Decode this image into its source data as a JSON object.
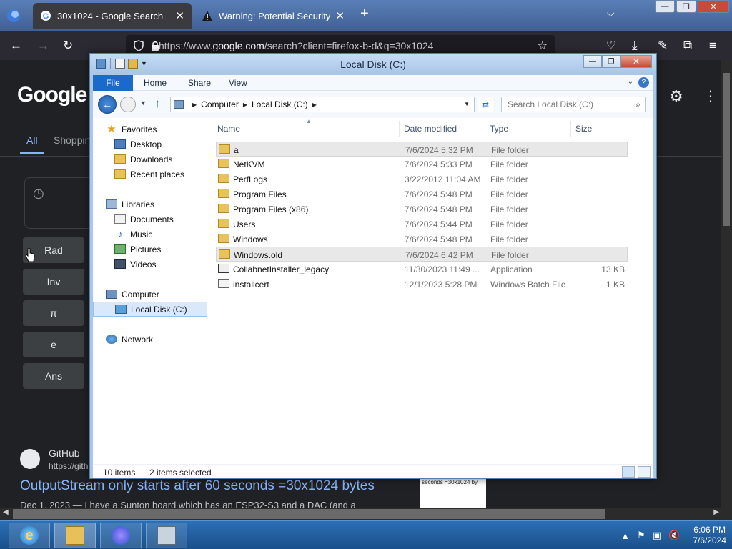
{
  "browser": {
    "tabs": [
      {
        "title": "30x1024 - Google Search",
        "icon": "google-icon",
        "active": true
      },
      {
        "title": "Warning: Potential Security Risk",
        "icon": "warning-icon",
        "active": false
      }
    ],
    "url_prefix": "https://www.",
    "url_domain": "google.com",
    "url_rest": "/search?client=firefox-b-d&q=30x1024",
    "window_controls": {
      "minimize": "—",
      "restore": "❐",
      "close": "✕"
    }
  },
  "google": {
    "logo": "Google",
    "tabs": [
      "All",
      "Shopping"
    ],
    "calculator_buttons": [
      "Rad",
      "Inv",
      "π",
      "e",
      "Ans"
    ],
    "result": {
      "site_name": "GitHub",
      "site_url": "https://githu",
      "title": "OutputStream only starts after 60 seconds =30x1024 bytes",
      "snippet": "Dec 1, 2023 — I have a Sunton board which has an ESP32-S3 and a DAC (and a",
      "thumb_text": "seconds =30x1024 by"
    }
  },
  "explorer": {
    "title": "Local Disk (C:)",
    "ribbon_tabs": [
      "File",
      "Home",
      "Share",
      "View"
    ],
    "breadcrumb": [
      "Computer",
      "Local Disk (C:)"
    ],
    "search_placeholder": "Search Local Disk (C:)",
    "nav": [
      {
        "label": "Favorites",
        "icon": "star-icon",
        "level": "root"
      },
      {
        "label": "Desktop",
        "icon": "desktop-icon",
        "level": "child"
      },
      {
        "label": "Downloads",
        "icon": "downloads-folder-icon",
        "level": "child"
      },
      {
        "label": "Recent places",
        "icon": "recent-places-icon",
        "level": "child"
      },
      {
        "label": "Libraries",
        "icon": "libraries-icon",
        "level": "root"
      },
      {
        "label": "Documents",
        "icon": "documents-icon",
        "level": "child"
      },
      {
        "label": "Music",
        "icon": "music-icon",
        "level": "child"
      },
      {
        "label": "Pictures",
        "icon": "pictures-icon",
        "level": "child"
      },
      {
        "label": "Videos",
        "icon": "videos-icon",
        "level": "child"
      },
      {
        "label": "Computer",
        "icon": "computer-icon",
        "level": "root"
      },
      {
        "label": "Local Disk (C:)",
        "icon": "drive-icon",
        "level": "child",
        "selected": true
      },
      {
        "label": "Network",
        "icon": "network-icon",
        "level": "root"
      }
    ],
    "columns": {
      "name": "Name",
      "date": "Date modified",
      "type": "Type",
      "size": "Size"
    },
    "files": [
      {
        "name": "a",
        "date": "7/6/2024 5:32 PM",
        "type": "File folder",
        "size": "",
        "kind": "folder",
        "selected": true
      },
      {
        "name": "NetKVM",
        "date": "7/6/2024 5:33 PM",
        "type": "File folder",
        "size": "",
        "kind": "folder"
      },
      {
        "name": "PerfLogs",
        "date": "3/22/2012 11:04 AM",
        "type": "File folder",
        "size": "",
        "kind": "folder"
      },
      {
        "name": "Program Files",
        "date": "7/6/2024 5:48 PM",
        "type": "File folder",
        "size": "",
        "kind": "folder"
      },
      {
        "name": "Program Files (x86)",
        "date": "7/6/2024 5:48 PM",
        "type": "File folder",
        "size": "",
        "kind": "folder"
      },
      {
        "name": "Users",
        "date": "7/6/2024 5:44 PM",
        "type": "File folder",
        "size": "",
        "kind": "folder"
      },
      {
        "name": "Windows",
        "date": "7/6/2024 5:48 PM",
        "type": "File folder",
        "size": "",
        "kind": "folder"
      },
      {
        "name": "Windows.old",
        "date": "7/6/2024 6:42 PM",
        "type": "File folder",
        "size": "",
        "kind": "folder",
        "selected": true
      },
      {
        "name": "CollabnetInstaller_legacy",
        "date": "11/30/2023 11:49 ...",
        "type": "Application",
        "size": "13 KB",
        "kind": "app"
      },
      {
        "name": "installcert",
        "date": "12/1/2023 5:28 PM",
        "type": "Windows Batch File",
        "size": "1 KB",
        "kind": "bat"
      }
    ],
    "status": {
      "count": "10 items",
      "selected": "2 items selected"
    }
  },
  "taskbar": {
    "time": "6:06 PM",
    "date": "7/6/2024"
  }
}
